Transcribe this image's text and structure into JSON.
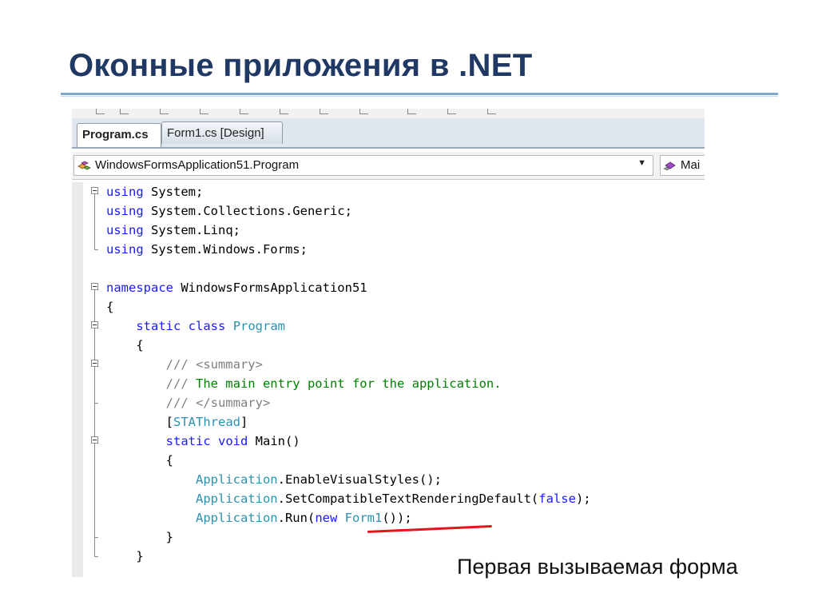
{
  "slide": {
    "title": "Оконные приложения в .NET",
    "caption": "Первая вызываемая форма"
  },
  "ide": {
    "tabs": [
      {
        "label": "Program.cs",
        "active": true
      },
      {
        "label": "Form1.cs [Design]",
        "active": false
      }
    ],
    "navbar": {
      "type_combo": "WindowsFormsApplication51.Program",
      "member_combo": "Mai"
    },
    "code_lines": [
      {
        "fold": "box",
        "tokens": [
          {
            "t": "kw",
            "v": "using"
          },
          {
            "t": "n",
            "v": " System;"
          }
        ]
      },
      {
        "fold": "line",
        "tokens": [
          {
            "t": "kw",
            "v": "using"
          },
          {
            "t": "n",
            "v": " System.Collections.Generic;"
          }
        ]
      },
      {
        "fold": "line",
        "tokens": [
          {
            "t": "kw",
            "v": "using"
          },
          {
            "t": "n",
            "v": " System.Linq;"
          }
        ]
      },
      {
        "fold": "end",
        "tokens": [
          {
            "t": "kw",
            "v": "using"
          },
          {
            "t": "n",
            "v": " System.Windows.Forms;"
          }
        ]
      },
      {
        "fold": "none",
        "tokens": []
      },
      {
        "fold": "box",
        "tokens": [
          {
            "t": "kw",
            "v": "namespace"
          },
          {
            "t": "n",
            "v": " WindowsFormsApplication51"
          }
        ]
      },
      {
        "fold": "line",
        "tokens": [
          {
            "t": "n",
            "v": "{"
          }
        ]
      },
      {
        "fold": "box",
        "tokens": [
          {
            "t": "n",
            "v": "    "
          },
          {
            "t": "kw",
            "v": "static"
          },
          {
            "t": "n",
            "v": " "
          },
          {
            "t": "kw",
            "v": "class"
          },
          {
            "t": "n",
            "v": " "
          },
          {
            "t": "ty",
            "v": "Program"
          }
        ]
      },
      {
        "fold": "line",
        "tokens": [
          {
            "t": "n",
            "v": "    {"
          }
        ]
      },
      {
        "fold": "box",
        "tokens": [
          {
            "t": "n",
            "v": "        "
          },
          {
            "t": "xd",
            "v": "/// <summary>"
          }
        ]
      },
      {
        "fold": "line",
        "tokens": [
          {
            "t": "n",
            "v": "        "
          },
          {
            "t": "xd",
            "v": "/// "
          },
          {
            "t": "cm",
            "v": "The main entry point for the application."
          }
        ]
      },
      {
        "fold": "end",
        "tokens": [
          {
            "t": "n",
            "v": "        "
          },
          {
            "t": "xd",
            "v": "/// </summary>"
          }
        ]
      },
      {
        "fold": "line",
        "tokens": [
          {
            "t": "n",
            "v": "        ["
          },
          {
            "t": "ty",
            "v": "STAThread"
          },
          {
            "t": "n",
            "v": "]"
          }
        ]
      },
      {
        "fold": "box",
        "tokens": [
          {
            "t": "n",
            "v": "        "
          },
          {
            "t": "kw",
            "v": "static"
          },
          {
            "t": "n",
            "v": " "
          },
          {
            "t": "kw",
            "v": "void"
          },
          {
            "t": "n",
            "v": " Main()"
          }
        ]
      },
      {
        "fold": "line",
        "tokens": [
          {
            "t": "n",
            "v": "        {"
          }
        ]
      },
      {
        "fold": "line",
        "tokens": [
          {
            "t": "n",
            "v": "            "
          },
          {
            "t": "ty",
            "v": "Application"
          },
          {
            "t": "n",
            "v": ".EnableVisualStyles();"
          }
        ]
      },
      {
        "fold": "line",
        "tokens": [
          {
            "t": "n",
            "v": "            "
          },
          {
            "t": "ty",
            "v": "Application"
          },
          {
            "t": "n",
            "v": ".SetCompatibleTextRenderingDefault("
          },
          {
            "t": "kw",
            "v": "false"
          },
          {
            "t": "n",
            "v": ");"
          }
        ]
      },
      {
        "fold": "line",
        "tokens": [
          {
            "t": "n",
            "v": "            "
          },
          {
            "t": "ty",
            "v": "Application"
          },
          {
            "t": "n",
            "v": ".Run("
          },
          {
            "t": "kw",
            "v": "new"
          },
          {
            "t": "n",
            "v": " "
          },
          {
            "t": "ty",
            "v": "Form1"
          },
          {
            "t": "n",
            "v": "());"
          }
        ]
      },
      {
        "fold": "end",
        "tokens": [
          {
            "t": "n",
            "v": "        }"
          }
        ]
      },
      {
        "fold": "end",
        "tokens": [
          {
            "t": "n",
            "v": "    }"
          }
        ]
      }
    ]
  },
  "colors": {
    "title": "#1f3864",
    "keyword": "#1a1aff",
    "type": "#2b91af",
    "comment": "#008000",
    "xmldoc": "#808080",
    "annotation_underline": "#e0161b"
  }
}
